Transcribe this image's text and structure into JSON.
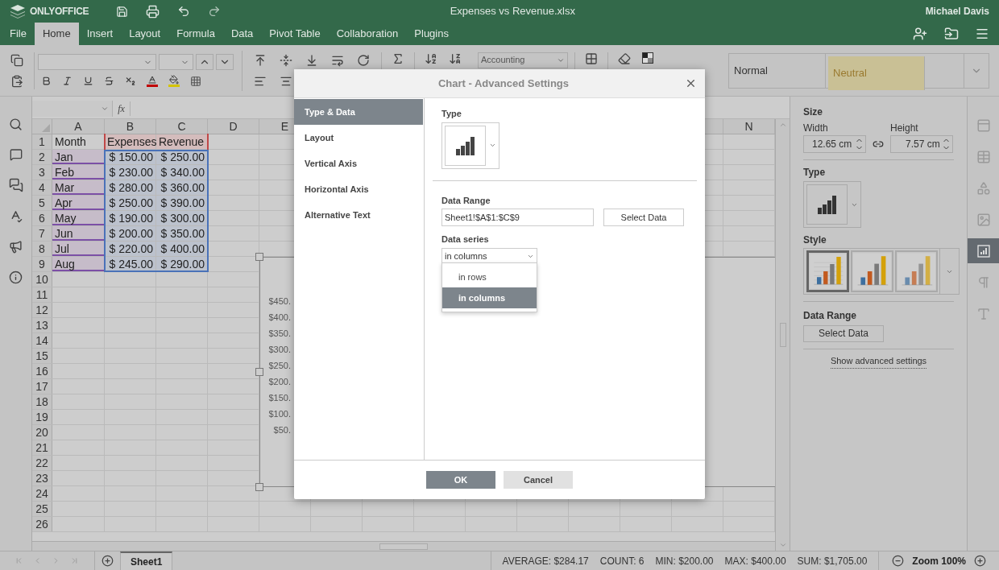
{
  "app": {
    "logo": "ONLYOFFICE",
    "title": "Expenses vs Revenue.xlsx",
    "user": "Michael Davis"
  },
  "menu_tabs": [
    {
      "label": "File",
      "selected": false
    },
    {
      "label": "Home",
      "selected": true
    },
    {
      "label": "Insert",
      "selected": false
    },
    {
      "label": "Layout",
      "selected": false
    },
    {
      "label": "Formula",
      "selected": false
    },
    {
      "label": "Data",
      "selected": false
    },
    {
      "label": "Pivot Table",
      "selected": false
    },
    {
      "label": "Collaboration",
      "selected": false
    },
    {
      "label": "Plugins",
      "selected": false
    }
  ],
  "toolbar": {
    "number_format": "Accounting",
    "cell_styles": [
      {
        "label": "Normal",
        "kind": "normal"
      },
      {
        "label": "Neutral",
        "kind": "neutral"
      }
    ]
  },
  "formula_bar": {
    "function_label": "fx"
  },
  "sheet": {
    "columns_left": [
      "A",
      "B",
      "C",
      "D",
      "E"
    ],
    "columns_right": [
      "N"
    ],
    "row_headers": [
      "1",
      "2",
      "3",
      "4",
      "5",
      "6",
      "7",
      "8",
      "9",
      "10",
      "11",
      "12",
      "13",
      "14",
      "15",
      "16",
      "17",
      "18",
      "19",
      "20",
      "21",
      "22",
      "23",
      "24",
      "25",
      "26"
    ],
    "data": [
      [
        "Month",
        "Expenses",
        "Revenue"
      ],
      [
        "Jan",
        "$ 150.00",
        "$ 250.00"
      ],
      [
        "Feb",
        "$ 230.00",
        "$ 340.00"
      ],
      [
        "Mar",
        "$ 280.00",
        "$ 360.00"
      ],
      [
        "Apr",
        "$ 250.00",
        "$ 390.00"
      ],
      [
        "May",
        "$ 190.00",
        "$ 300.00"
      ],
      [
        "Jun",
        "$ 200.00",
        "$ 350.00"
      ],
      [
        "Jul",
        "$ 220.00",
        "$ 400.00"
      ],
      [
        "Aug",
        "$ 245.00",
        "$ 290.00"
      ]
    ],
    "chart_axis_labels": [
      "$450.",
      "$400.",
      "$350.",
      "$300.",
      "$250.",
      "$200.",
      "$150.",
      "$100.",
      "$50."
    ]
  },
  "right_panel": {
    "size_label": "Size",
    "width_label": "Width",
    "width_value": "12.65 cm",
    "height_label": "Height",
    "height_value": "7.57 cm",
    "type_label": "Type",
    "style_label": "Style",
    "styles": [
      {
        "selected": true
      },
      {
        "selected": false
      },
      {
        "selected": false
      }
    ],
    "data_range_label": "Data Range",
    "select_data": "Select Data",
    "advanced_link": "Show advanced settings"
  },
  "right_tabs": [
    {
      "kind": "header",
      "selected": false
    },
    {
      "kind": "table",
      "selected": false
    },
    {
      "kind": "shape",
      "selected": false
    },
    {
      "kind": "image",
      "selected": false
    },
    {
      "kind": "chart",
      "selected": true
    },
    {
      "kind": "paragraph",
      "selected": false
    },
    {
      "kind": "textart",
      "selected": false
    }
  ],
  "dialog": {
    "title": "Chart - Advanced Settings",
    "nav": [
      {
        "label": "Type & Data",
        "selected": true
      },
      {
        "label": "Layout",
        "selected": false
      },
      {
        "label": "Vertical Axis",
        "selected": false
      },
      {
        "label": "Horizontal Axis",
        "selected": false
      },
      {
        "label": "Alternative Text",
        "selected": false
      }
    ],
    "type_label": "Type",
    "data_range_label": "Data Range",
    "data_range_value": "Sheet1!$A$1:$C$9",
    "select_data": "Select Data",
    "data_series_label": "Data series",
    "data_series_value": "in columns",
    "data_series_options": [
      {
        "label": "in rows",
        "selected": false
      },
      {
        "label": "in columns",
        "selected": true
      }
    ],
    "ok": "OK",
    "cancel": "Cancel"
  },
  "status_bar": {
    "sheet_tab": "Sheet1",
    "stats": [
      "AVERAGE: $284.17",
      "COUNT: 6",
      "MIN: $200.00",
      "MAX: $400.00",
      "SUM: $1,705.00"
    ],
    "zoom": "Zoom 100%"
  }
}
